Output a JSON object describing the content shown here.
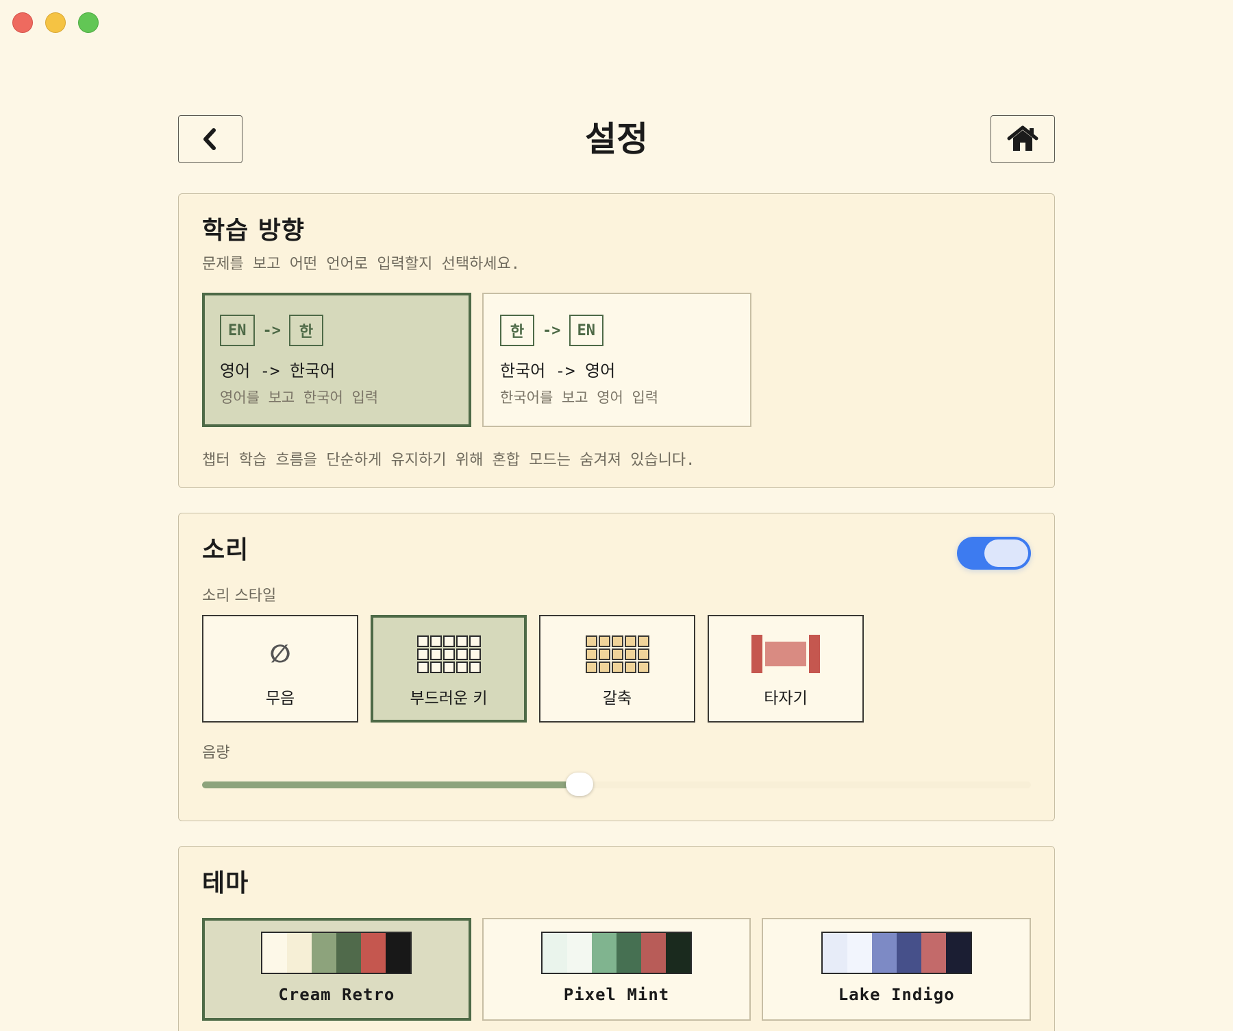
{
  "header": {
    "title": "설정",
    "back_icon": "chevron-left-icon",
    "home_icon": "home-icon"
  },
  "direction": {
    "title": "학습 방향",
    "description": "문제를 보고 어떤 언어로 입력할지 선택하세요.",
    "options": [
      {
        "from_chip": "EN",
        "arrow": "->",
        "to_chip": "한",
        "title": "영어 -> 한국어",
        "subtitle": "영어를 보고 한국어 입력",
        "selected": true
      },
      {
        "from_chip": "한",
        "arrow": "->",
        "to_chip": "EN",
        "title": "한국어 -> 영어",
        "subtitle": "한국어를 보고 영어 입력",
        "selected": false
      }
    ],
    "note": "챕터 학습 흐름을 단순하게 유지하기 위해 혼합 모드는 숨겨져 있습니다."
  },
  "sound": {
    "title": "소리",
    "enabled": true,
    "style_label": "소리 스타일",
    "styles": [
      {
        "label": "무음",
        "glyph": "∅",
        "icon": "mute-icon",
        "selected": false
      },
      {
        "label": "부드러운 키",
        "icon": "soft-keys-icon",
        "selected": true
      },
      {
        "label": "갈축",
        "icon": "brown-switch-keys-icon",
        "selected": false
      },
      {
        "label": "타자기",
        "icon": "typewriter-icon",
        "selected": false
      }
    ],
    "volume_label": "음량",
    "volume_fraction": 0.455
  },
  "theme": {
    "title": "테마",
    "options": [
      {
        "name": "Cream Retro",
        "selected": true,
        "colors": [
          "#fdf8e8",
          "#f6efd6",
          "#8da37c",
          "#506a4b",
          "#c5574f",
          "#181818"
        ]
      },
      {
        "name": "Pixel Mint",
        "selected": false,
        "colors": [
          "#eaf4ec",
          "#f3f8f1",
          "#80b48f",
          "#467052",
          "#b85c58",
          "#1a2a1e"
        ]
      },
      {
        "name": "Lake Indigo",
        "selected": false,
        "colors": [
          "#e7ecf8",
          "#f2f5fd",
          "#7d8ac5",
          "#46508a",
          "#c36a6a",
          "#1b1e33"
        ]
      }
    ]
  }
}
